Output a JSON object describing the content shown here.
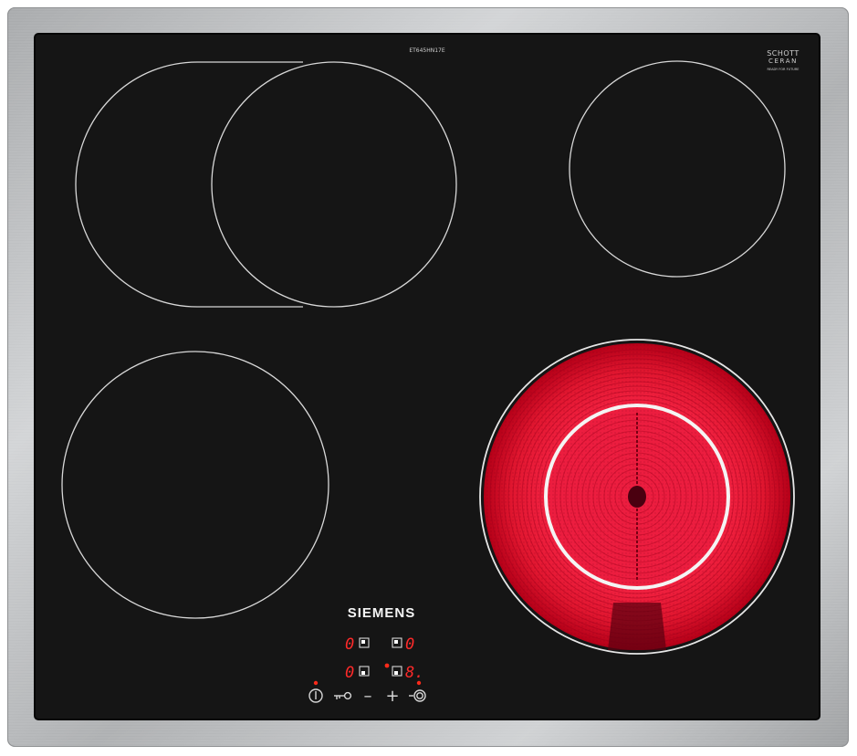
{
  "panel": {
    "model": "ET645HN17E",
    "glass_brand_line1": "SCHOTT",
    "glass_brand_line2": "CERAN",
    "glass_sub": "READY FOR FUTURE",
    "brand": "SIEMENS"
  },
  "colors": {
    "frame": "#b9bbbd",
    "glass": "#151515",
    "heat_red": "#e8163a",
    "led_red": "#ff2a1a"
  },
  "zones": [
    {
      "name": "front-left-zone",
      "state": "off"
    },
    {
      "name": "rear-left-dual-zone",
      "state": "off"
    },
    {
      "name": "rear-right-zone",
      "state": "off"
    },
    {
      "name": "front-right-dual-zone",
      "state": "on"
    }
  ],
  "displays": {
    "rear_left": "0",
    "rear_right": "0",
    "front_left": "0",
    "front_right": "8."
  },
  "controls": {
    "power_icon": "power-icon",
    "lock_icon": "key-lock-icon",
    "minus": "–",
    "plus": "+",
    "dual_icon": "dual-ring-icon"
  }
}
